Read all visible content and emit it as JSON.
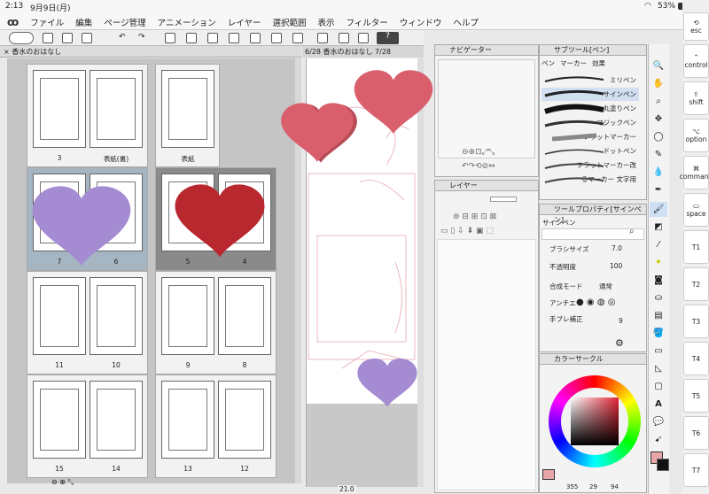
{
  "status": {
    "time": "2:13",
    "date": "9月9日(月)",
    "battery": "53%"
  },
  "menu": [
    "ファイル",
    "編集",
    "ページ管理",
    "アニメーション",
    "レイヤー",
    "選択範囲",
    "表示",
    "フィルター",
    "ウィンドウ",
    "ヘルプ"
  ],
  "left_tab": "香水のおはなし",
  "canvas_tab": "6/28 香水のおはなし 7/28",
  "pages": {
    "rows": [
      {
        "a": "3",
        "b": "表紙(裏)",
        "c": "表紙",
        "d": ""
      },
      {
        "a": "7",
        "b": "6",
        "c": "5",
        "d": "4"
      },
      {
        "a": "11",
        "b": "10",
        "c": "9",
        "d": "8"
      },
      {
        "a": "15",
        "b": "14",
        "c": "13",
        "d": "12"
      }
    ]
  },
  "navigator": {
    "title": "ナビゲーター"
  },
  "layer": {
    "title": "レイヤー"
  },
  "subtool": {
    "title": "サブツール[ペン]",
    "tabs": [
      "ペン",
      "マーカー",
      "効果"
    ],
    "brushes": [
      "ミリペン",
      "サインペン",
      "丸塗りペン",
      "マジックペン",
      "フラットマーカー",
      "ドットペン",
      "フラットマーカー改",
      "るマーカー 文字用"
    ]
  },
  "toolprop": {
    "title": "ツールプロパティ[サインペン]",
    "tool": "サインペン",
    "size_label": "ブラシサイズ",
    "size_value": "7.0",
    "opacity_label": "不透明度",
    "opacity_value": "100",
    "blend_label": "合成モード",
    "blend_value": "通常",
    "aa_label": "アンチエ",
    "stab_label": "手ブレ補正",
    "stab_value": "9"
  },
  "color": {
    "title": "カラーサークル",
    "h": "355",
    "s": "29",
    "v": "94"
  },
  "canvas_zoom": "21.0",
  "keys": [
    "esc",
    "control",
    "shift",
    "option",
    "command",
    "space",
    "T1",
    "T2",
    "T3",
    "T4",
    "T5",
    "T6",
    "T7"
  ],
  "hearts": {
    "colors": {
      "pink": "#d95f6d",
      "purple": "#a58bd2",
      "red": "#b9272f"
    }
  }
}
